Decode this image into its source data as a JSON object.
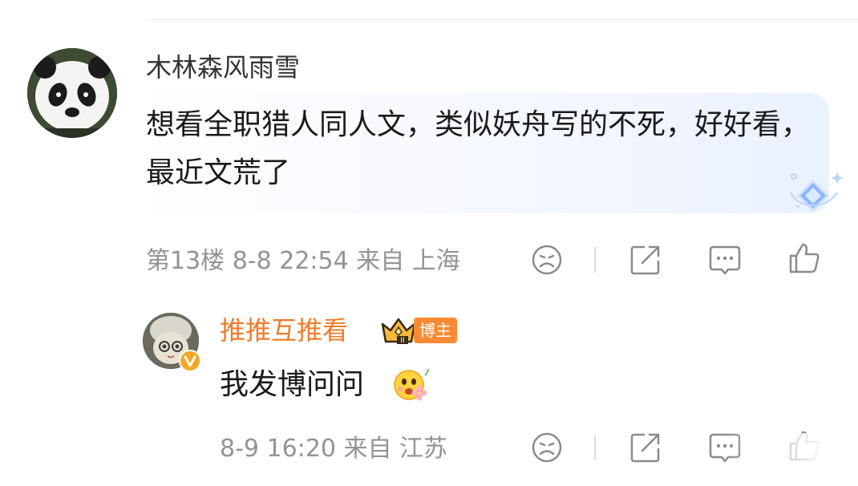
{
  "comment": {
    "username": "木林森风雨雪",
    "text": "想看全职猎人同人文，类似妖舟写的不死，好好看，最近文荒了",
    "meta": "第13楼 8-8 22:54 来自 上海"
  },
  "reply": {
    "username": "推推互推看",
    "badge": "博主",
    "text": "我发博问问",
    "meta": "8-9 16:20 来自 江苏"
  },
  "colors": {
    "author_name": "#f07b2a",
    "badge_bg": "#fb8a33",
    "meta_text": "#939393",
    "icon_stroke": "#8a8a8a"
  },
  "icons": [
    "sad-face-icon",
    "share-icon",
    "comment-icon",
    "like-icon"
  ]
}
